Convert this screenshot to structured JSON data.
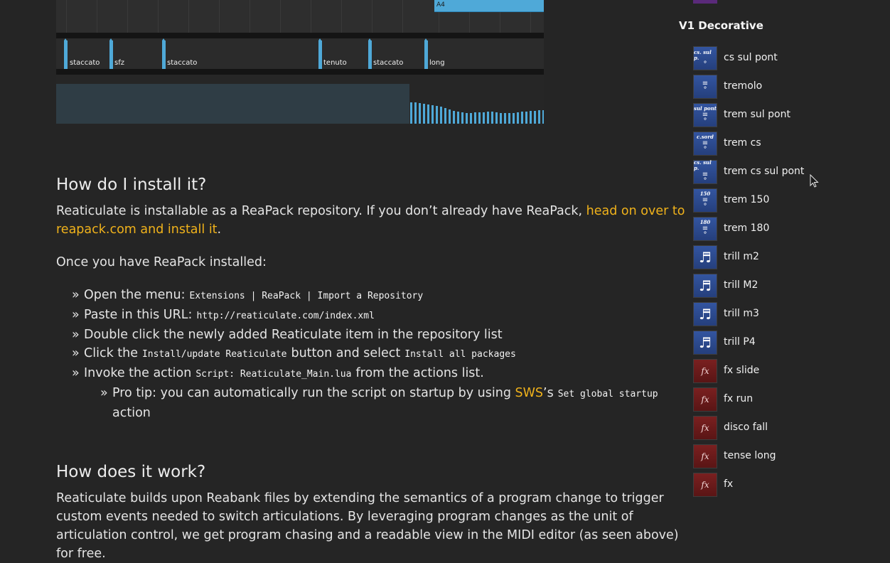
{
  "midi_editor": {
    "note_label": "A4",
    "articulation_markers": [
      "staccato",
      "sfz",
      "staccato",
      "tenuto",
      "staccato",
      "long"
    ]
  },
  "article": {
    "install_heading": "How do I install it?",
    "install_para_text": "Reaticulate is installable as a ReaPack repository. If you don’t already have ReaPack, ",
    "install_para_link": "head on over to reapack.com and install it",
    "install_para_end": ".",
    "once_installed": "Once you have ReaPack installed:",
    "steps": {
      "s1_text": "Open the menu:",
      "s1_code": "Extensions | ReaPack | Import a Repository",
      "s2_text": "Paste in this URL:",
      "s2_code": "http://reaticulate.com/index.xml",
      "s3_text": "Double click the newly added Reaticulate item in the repository list",
      "s4_text_a": "Click the",
      "s4_code_a": "Install/update Reaticulate",
      "s4_text_b": "button and select",
      "s4_code_b": "Install all packages",
      "s5_text_a": "Invoke the action",
      "s5_code": "Script: Reaticulate_Main.lua",
      "s5_text_b": "from the actions list.",
      "tip_text_a": "Pro tip: you can automatically run the script on startup by using ",
      "tip_link": "SWS",
      "tip_text_b": "’s",
      "tip_code": "Set global startup",
      "tip_text_c": "action"
    },
    "how_heading": "How does it work?",
    "how_para": "Reaticulate builds upon Reabank files by extending the semantics of a program change to trigger custom events needed to switch articulations. By leveraging program changes as the unit of articulation control, we get program chasing and a readable view in the MIDI editor (as seen above) for free."
  },
  "sidebar": {
    "title": "V1 Decorative",
    "items": [
      {
        "label": "cs sul pont",
        "icon": "cs-sul-pont-icon",
        "badge": "cs. sul p."
      },
      {
        "label": "tremolo",
        "icon": "tremolo-icon",
        "badge": ""
      },
      {
        "label": "trem sul pont",
        "icon": "trem-sul-pont-icon",
        "badge": "sul pont"
      },
      {
        "label": "trem cs",
        "icon": "trem-cs-icon",
        "badge": "c.sord"
      },
      {
        "label": "trem cs sul pont",
        "icon": "trem-cs-sul-pont-icon",
        "badge": "cs. sul p."
      },
      {
        "label": "trem 150",
        "icon": "trem-150-icon",
        "badge": "150"
      },
      {
        "label": "trem 180",
        "icon": "trem-180-icon",
        "badge": "180"
      },
      {
        "label": "trill m2",
        "icon": "trill-m2-icon",
        "badge": ""
      },
      {
        "label": "trill M2",
        "icon": "trill-M2-icon",
        "badge": ""
      },
      {
        "label": "trill m3",
        "icon": "trill-m3-icon",
        "badge": ""
      },
      {
        "label": "trill P4",
        "icon": "trill-P4-icon",
        "badge": ""
      },
      {
        "label": "fx slide",
        "icon": "fx-slide-icon",
        "badge": "fx"
      },
      {
        "label": "fx run",
        "icon": "fx-run-icon",
        "badge": "fx"
      },
      {
        "label": "disco fall",
        "icon": "disco-fall-icon",
        "badge": "fx"
      },
      {
        "label": "tense long",
        "icon": "tense-long-icon",
        "badge": "fx"
      },
      {
        "label": "fx",
        "icon": "fx-icon",
        "badge": "fx"
      }
    ]
  },
  "colors": {
    "background": "#252525",
    "link": "#f0b21b",
    "accent_blue": "#4fa9d8",
    "icon_blue": "#2d4a8e",
    "icon_red": "#6a1a1a"
  }
}
